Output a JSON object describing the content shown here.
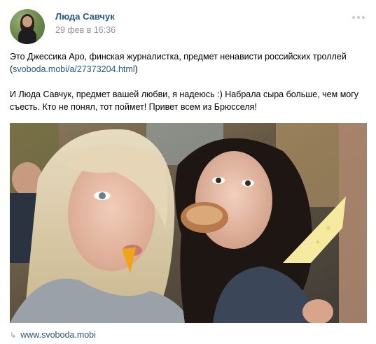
{
  "post": {
    "author": "Люда Савчук",
    "date": "29 фев в 16:36",
    "text_line1": "Это Джессика Аро, финская журналистка, предмет ненависти российских троллей",
    "text_link_paren_open": "(",
    "text_link": "svoboda.mobi/a/27373204.html",
    "text_link_paren_close": ")",
    "text_para2": "И Люда Савчук, предмет вашей любви, я надеюсь :) Набрала сыра больше, чем могу съесть. Кто не понял, тот поймет! Привет всем из Брюсселя!",
    "footer_link": "www.svoboda.mobi"
  },
  "icons": {
    "more": "more-dots-icon",
    "footer": "link-icon"
  },
  "colors": {
    "link": "#2a5885",
    "muted": "#939393"
  }
}
